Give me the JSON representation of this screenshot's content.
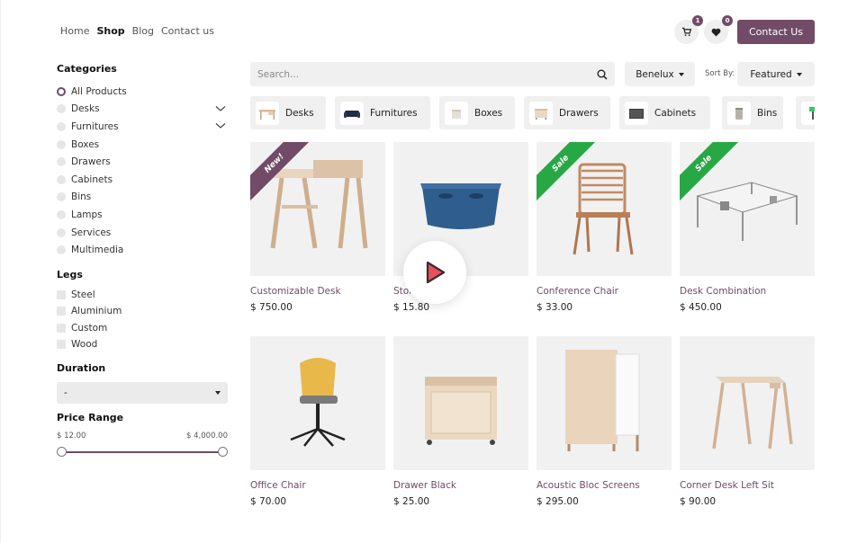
{
  "nav": {
    "items": [
      {
        "label": "Home",
        "active": false
      },
      {
        "label": "Shop",
        "active": true
      },
      {
        "label": "Blog",
        "active": false
      },
      {
        "label": "Contact us",
        "active": false
      }
    ]
  },
  "header": {
    "cart_count": "1",
    "wishlist_count": "0",
    "contact_label": "Contact Us"
  },
  "sidebar": {
    "categories_title": "Categories",
    "categories": [
      {
        "label": "All Products",
        "checked": true,
        "expandable": false
      },
      {
        "label": "Desks",
        "checked": false,
        "expandable": true
      },
      {
        "label": "Furnitures",
        "checked": false,
        "expandable": true
      },
      {
        "label": "Boxes",
        "checked": false,
        "expandable": false
      },
      {
        "label": "Drawers",
        "checked": false,
        "expandable": false
      },
      {
        "label": "Cabinets",
        "checked": false,
        "expandable": false
      },
      {
        "label": "Bins",
        "checked": false,
        "expandable": false
      },
      {
        "label": "Lamps",
        "checked": false,
        "expandable": false
      },
      {
        "label": "Services",
        "checked": false,
        "expandable": false
      },
      {
        "label": "Multimedia",
        "checked": false,
        "expandable": false
      }
    ],
    "legs_title": "Legs",
    "legs": [
      "Steel",
      "Aluminium",
      "Custom",
      "Wood"
    ],
    "duration_title": "Duration",
    "duration_value": "-",
    "price_title": "Price Range",
    "price_min": "$ 12.00",
    "price_max": "$ 4,000.00"
  },
  "toolbar": {
    "search_placeholder": "Search...",
    "pricelist": "Benelux",
    "sort_label": "Sort By:",
    "sort_value": "Featured"
  },
  "category_bar": [
    {
      "label": "Desks",
      "icon": "desk-icon"
    },
    {
      "label": "Furnitures",
      "icon": "sofa-icon"
    },
    {
      "label": "Boxes",
      "icon": "box-icon"
    },
    {
      "label": "Drawers",
      "icon": "drawer-icon"
    },
    {
      "label": "Cabinets",
      "icon": "cabinet-icon"
    },
    {
      "label": "Bins",
      "icon": "bin-icon"
    }
  ],
  "products": [
    {
      "name": "Customizable Desk",
      "price": "$ 750.00",
      "ribbon": "New!",
      "ribbon_color": "#714b67"
    },
    {
      "name": "Stor",
      "price": "$ 15.80",
      "ribbon": "",
      "ribbon_color": ""
    },
    {
      "name": "Conference Chair",
      "price": "$ 33.00",
      "ribbon": "Sale",
      "ribbon_color": "#28a745"
    },
    {
      "name": "Desk Combination",
      "price": "$ 450.00",
      "ribbon": "Sale",
      "ribbon_color": "#28a745"
    },
    {
      "name": "Office Chair",
      "price": "$ 70.00",
      "ribbon": "",
      "ribbon_color": ""
    },
    {
      "name": "Drawer Black",
      "price": "$ 25.00",
      "ribbon": "",
      "ribbon_color": ""
    },
    {
      "name": "Acoustic Bloc Screens",
      "price": "$ 295.00",
      "ribbon": "",
      "ribbon_color": ""
    },
    {
      "name": "Corner Desk Left Sit",
      "price": "$ 90.00",
      "ribbon": "",
      "ribbon_color": ""
    }
  ],
  "colors": {
    "brand": "#714b67",
    "sale": "#28a745",
    "play": "#e8505b"
  }
}
